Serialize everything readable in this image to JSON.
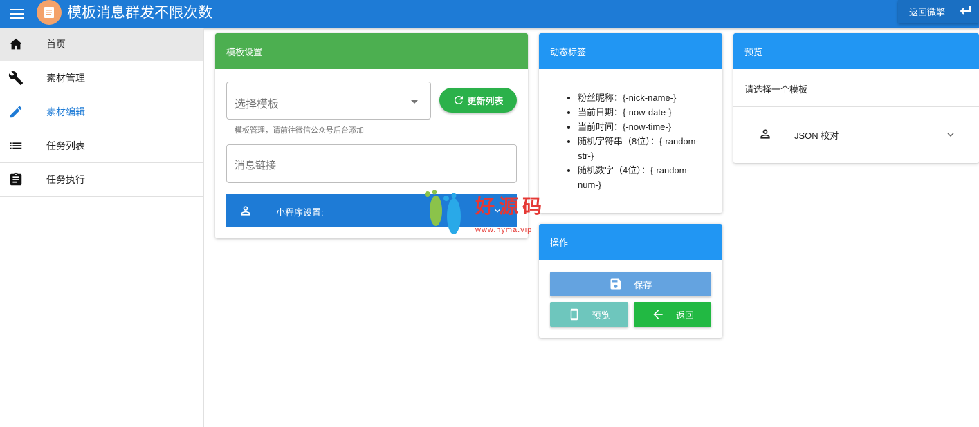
{
  "header": {
    "title": "模板消息群发不限次数",
    "back_label": "返回微擎"
  },
  "sidebar": {
    "items": [
      {
        "label": "首页",
        "icon": "home-icon"
      },
      {
        "label": "素材管理",
        "icon": "wrench-icon"
      },
      {
        "label": "素材编辑",
        "icon": "pencil-icon"
      },
      {
        "label": "任务列表",
        "icon": "list-icon"
      },
      {
        "label": "任务执行",
        "icon": "clipboard-icon"
      }
    ]
  },
  "template_settings": {
    "title": "模板设置",
    "select_placeholder": "选择模板",
    "refresh_label": "更新列表",
    "hint": "模板管理，请前往微信公众号后台添加",
    "link_placeholder": "消息链接",
    "miniprogram_label": "小程序设置:"
  },
  "dynamic_tags": {
    "title": "动态标签",
    "items": [
      "粉丝昵称：{-nick-name-}",
      "当前日期：{-now-date-}",
      "当前时间：{-now-time-}",
      "随机字符串（8位）：{-random-str-}",
      "随机数字（4位）：{-random-num-}"
    ]
  },
  "operations": {
    "title": "操作",
    "save_label": "保存",
    "preview_label": "预览",
    "return_label": "返回"
  },
  "preview": {
    "title": "预览",
    "hint": "请选择一个模板",
    "json_label": "JSON 校对"
  },
  "watermark": {
    "text": "好源码",
    "url": "www.hyma.vip"
  },
  "colors": {
    "primary": "#1e7bd6",
    "green_header": "#4caf50",
    "blue_header": "#2196f3"
  }
}
